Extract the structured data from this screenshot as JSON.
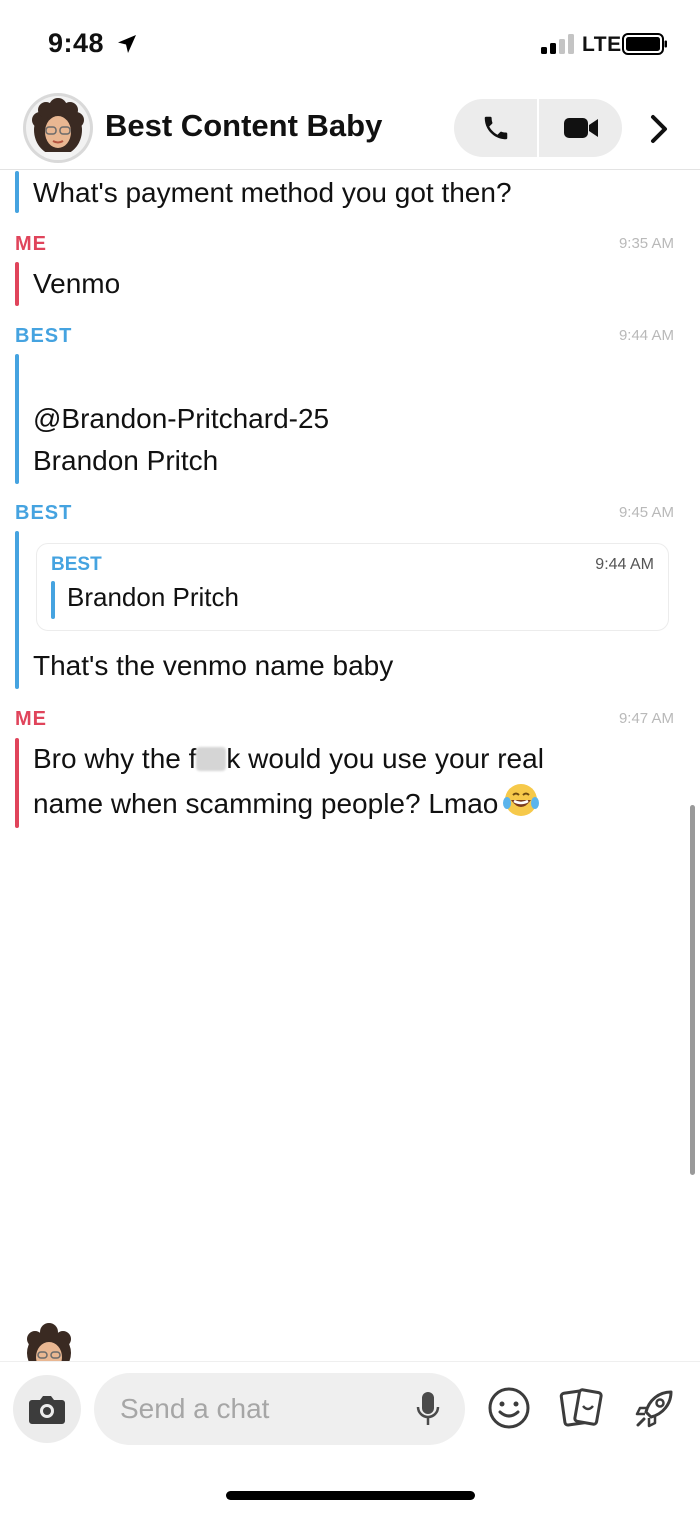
{
  "status_bar": {
    "time": "9:48",
    "carrier": "LTE"
  },
  "header": {
    "title": "Best Content Baby"
  },
  "colors": {
    "me": "#e0445b",
    "best": "#45a3e0",
    "timestamp": "#b9b9b9"
  },
  "messages": [
    {
      "lines": [
        "What's payment method you got then?"
      ]
    },
    {
      "sender": "ME",
      "time": "9:35 AM",
      "lines": [
        "Venmo"
      ]
    },
    {
      "sender": "BEST",
      "time": "9:44 AM",
      "lines": [
        "@Brandon-Pritchard-25",
        "Brandon Pritch"
      ]
    },
    {
      "sender": "BEST",
      "time": "9:45 AM",
      "quote": {
        "sender": "BEST",
        "time": "9:44 AM",
        "text": "Brandon Pritch"
      },
      "lines": [
        "That's the venmo name baby"
      ]
    },
    {
      "sender": "ME",
      "time": "9:47 AM",
      "line1_before": "Bro why the f",
      "line1_after": "k would you use your real",
      "line2": "name when scamming people? Lmao"
    }
  ],
  "composer": {
    "placeholder": "Send a chat"
  },
  "icons": {
    "location": "location-arrow-icon",
    "signal": "cellular-signal-icon",
    "battery": "battery-icon",
    "call": "phone-icon",
    "video": "video-camera-icon",
    "more": "chevron-right-icon",
    "camera": "camera-icon",
    "mic": "microphone-icon",
    "emoji": "smiley-icon",
    "stickers": "sticker-cards-icon",
    "games": "rocket-icon",
    "laugh": "laughing-tears-emoji"
  }
}
